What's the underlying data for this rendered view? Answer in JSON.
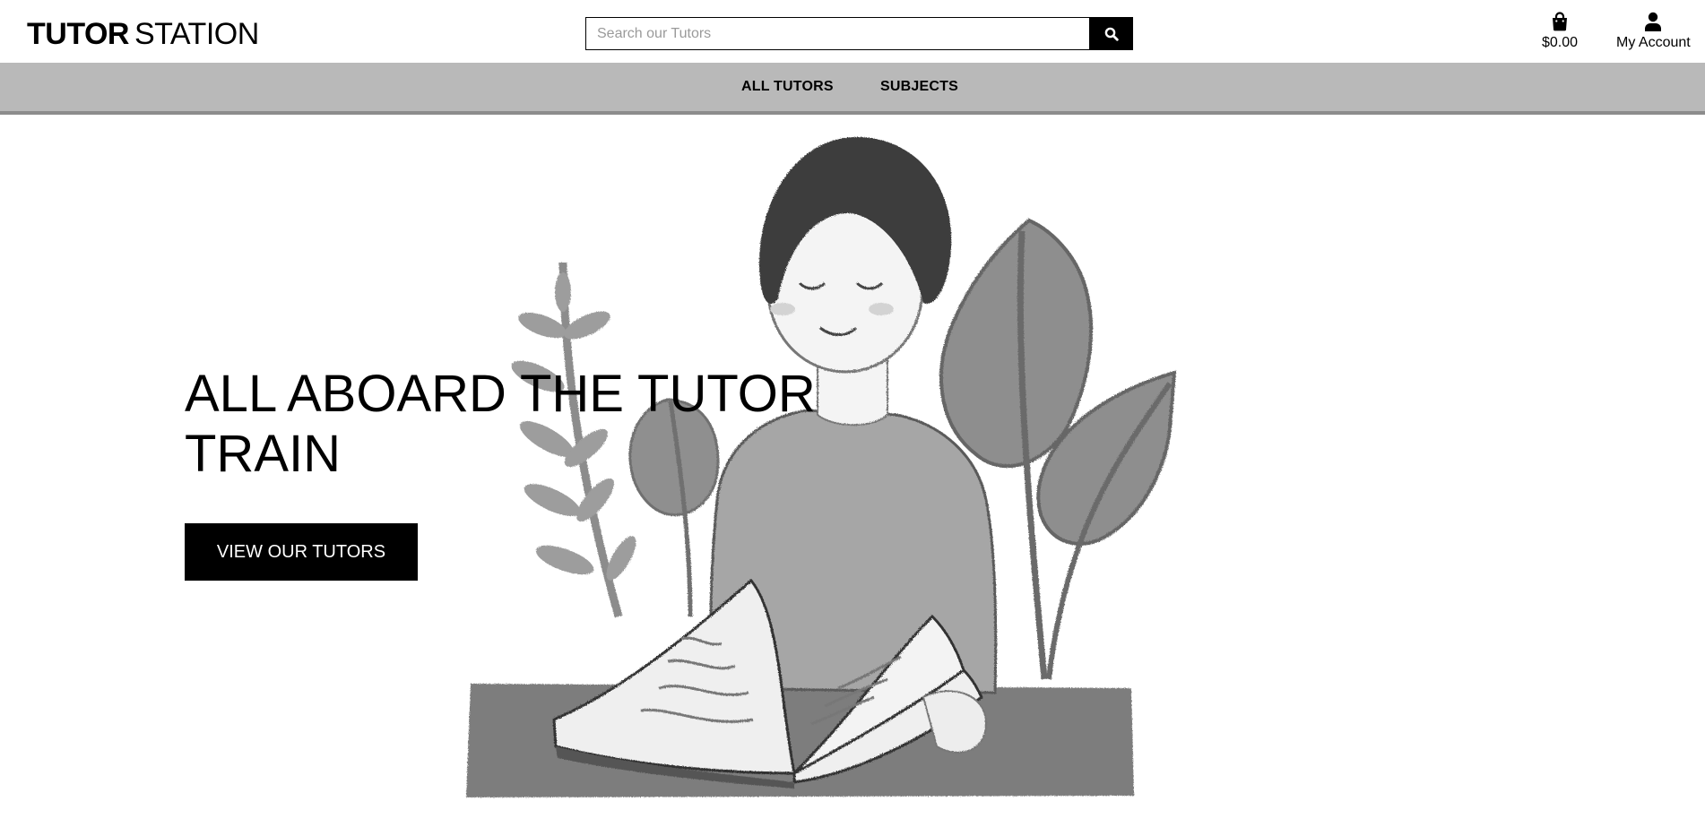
{
  "header": {
    "logo_bold": "TUTOR",
    "logo_light": "STATION",
    "search": {
      "placeholder": "Search our Tutors",
      "value": "",
      "icon": "search-icon"
    },
    "bag": {
      "icon": "shopping-bag-icon",
      "label": "$0.00"
    },
    "account": {
      "icon": "user-icon",
      "label": "My Account"
    }
  },
  "nav": {
    "items": [
      {
        "label": "ALL TUTORS"
      },
      {
        "label": "SUBJECTS"
      }
    ]
  },
  "hero": {
    "title": "ALL ABOARD THE TUTOR TRAIN",
    "cta_label": "VIEW OUR TUTORS",
    "illustration": "grayscale-child-reading-book-with-plants"
  },
  "colors": {
    "nav_background": "#b9b9b9",
    "button_background": "#000000",
    "button_text": "#ffffff"
  }
}
